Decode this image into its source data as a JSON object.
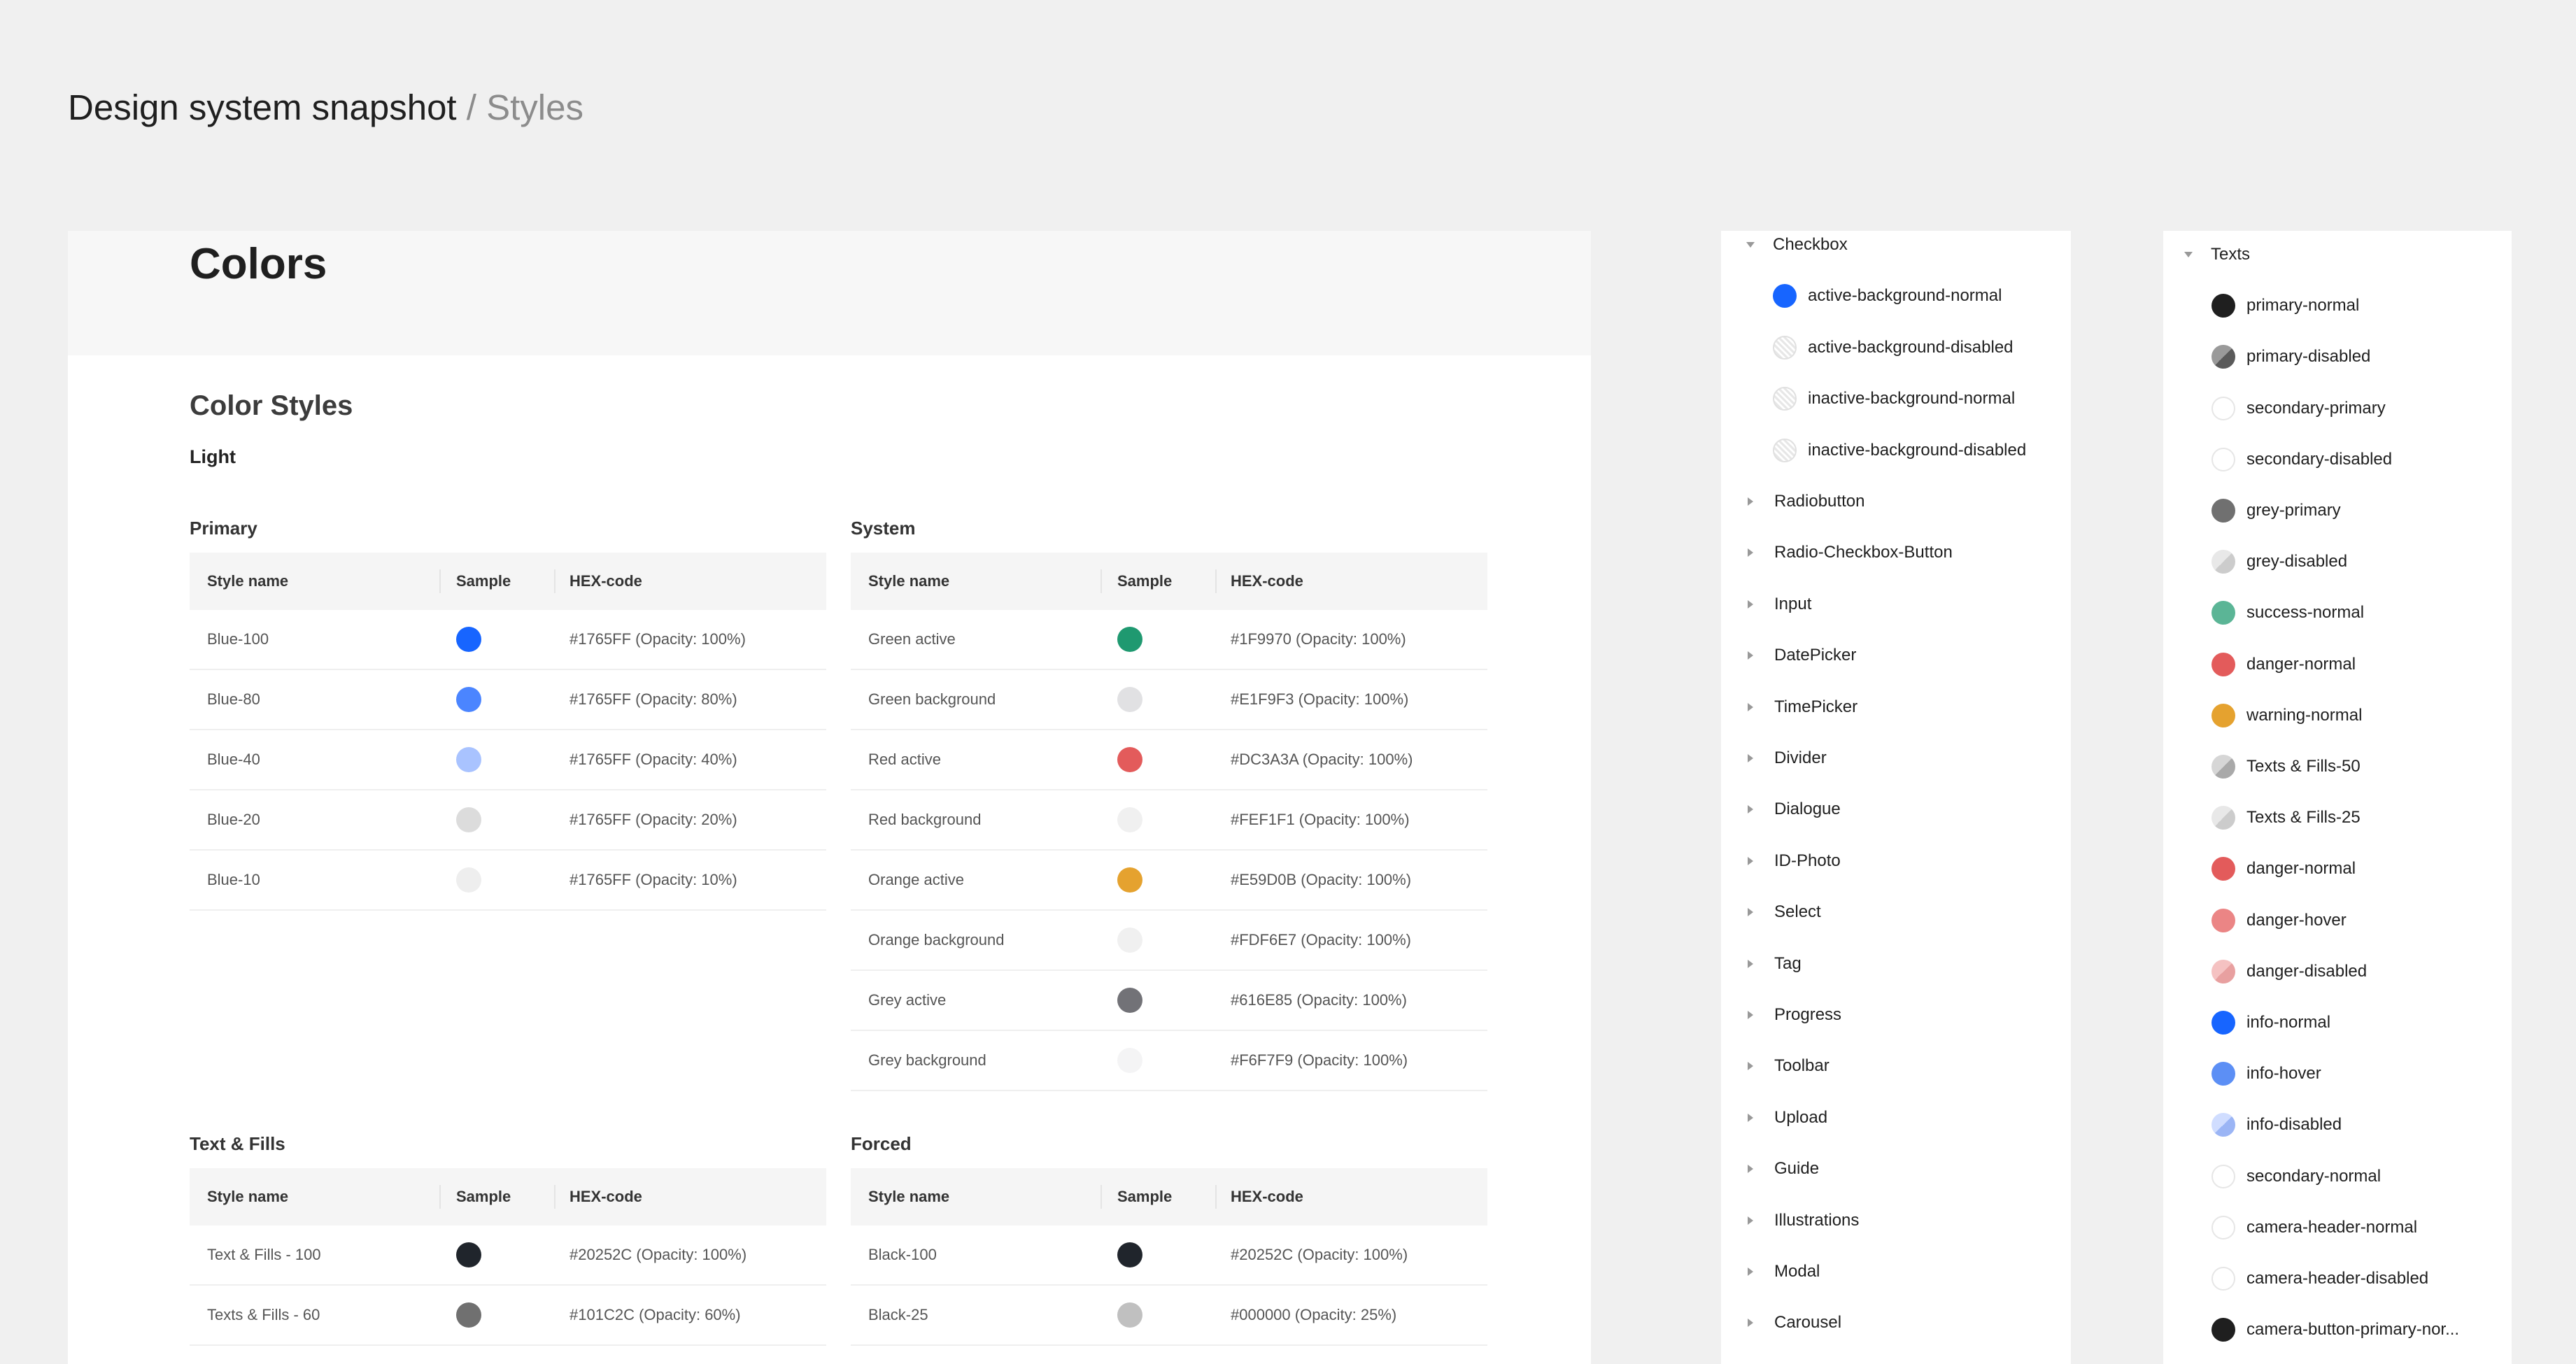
{
  "page": {
    "title": "Design system snapshot",
    "separator": " / ",
    "section": "Styles"
  },
  "board": {
    "title": "Colors",
    "subtitle": "Color Styles",
    "mode": "Light",
    "columns": {
      "name": "Style name",
      "sample": "Sample",
      "hex": "HEX-code"
    },
    "groups": {
      "primary": {
        "title": "Primary",
        "rows": [
          {
            "name": "Blue-100",
            "color": "#1765FF",
            "hex": "#1765FF (Opacity: 100%)"
          },
          {
            "name": "Blue-80",
            "color": "#4B85FF",
            "hex": "#1765FF (Opacity: 80%)"
          },
          {
            "name": "Blue-40",
            "color": "#A9C3FF",
            "hex": "#1765FF (Opacity: 40%)"
          },
          {
            "name": "Blue-20",
            "color": "#DCDCDC",
            "hex": "#1765FF (Opacity: 20%)"
          },
          {
            "name": "Blue-10",
            "color": "#EEEEEE",
            "hex": "#1765FF (Opacity: 10%)"
          }
        ]
      },
      "system": {
        "title": "System",
        "rows": [
          {
            "name": "Green active",
            "color": "#1F9970",
            "hex": "#1F9970 (Opacity: 100%)"
          },
          {
            "name": "Green background",
            "color": "#E1E1E3",
            "hex": "#E1F9F3 (Opacity: 100%)"
          },
          {
            "name": "Red active",
            "color": "#E35B5B",
            "hex": "#DC3A3A (Opacity: 100%)"
          },
          {
            "name": "Red background",
            "color": "#F0F0F0",
            "hex": "#FEF1F1 (Opacity: 100%)"
          },
          {
            "name": "Orange active",
            "color": "#E5A22F",
            "hex": "#E59D0B (Opacity: 100%)"
          },
          {
            "name": "Orange background",
            "color": "#F0F0F0",
            "hex": "#FDF6E7 (Opacity: 100%)"
          },
          {
            "name": "Grey active",
            "color": "#727277",
            "hex": "#616E85 (Opacity: 100%)"
          },
          {
            "name": "Grey background",
            "color": "#F4F4F5",
            "hex": "#F6F7F9 (Opacity: 100%)"
          }
        ]
      },
      "text_fills": {
        "title": "Text & Fills",
        "rows": [
          {
            "name": "Text & Fills - 100",
            "color": "#20252C",
            "hex": "#20252C (Opacity: 100%)"
          },
          {
            "name": "Texts & Fills - 60",
            "color": "#707070",
            "hex": "#101C2C (Opacity: 60%)"
          }
        ]
      },
      "forced": {
        "title": "Forced",
        "rows": [
          {
            "name": "Black-100",
            "color": "#20252C",
            "hex": "#20252C (Opacity: 100%)"
          },
          {
            "name": "Black-25",
            "color": "#C0C0C0",
            "hex": "#000000 (Opacity: 25%)"
          }
        ]
      }
    }
  },
  "components_panel": {
    "expanded_title": "Checkbox",
    "expanded_items": [
      {
        "label": "active-background-normal",
        "swatch": "solid",
        "color": "#1765FF"
      },
      {
        "label": "active-background-disabled",
        "swatch": "hatch"
      },
      {
        "label": "inactive-background-normal",
        "swatch": "hatch"
      },
      {
        "label": "inactive-background-disabled",
        "swatch": "hatch"
      }
    ],
    "collapsed": [
      "Radiobutton",
      "Radio-Checkbox-Button",
      "Input",
      "DatePicker",
      "TimePicker",
      "Divider",
      "Dialogue",
      "ID-Photo",
      "Select",
      "Tag",
      "Progress",
      "Toolbar",
      "Upload",
      "Guide",
      "Illustrations",
      "Modal",
      "Carousel"
    ]
  },
  "texts_panel": {
    "title": "Texts",
    "items": [
      {
        "label": "primary-normal",
        "swatch": "solid",
        "color": "#1F1F1F"
      },
      {
        "label": "primary-disabled",
        "swatch": "split-dark"
      },
      {
        "label": "secondary-primary",
        "swatch": "empty"
      },
      {
        "label": "secondary-disabled",
        "swatch": "empty"
      },
      {
        "label": "grey-primary",
        "swatch": "solid",
        "color": "#707070"
      },
      {
        "label": "grey-disabled",
        "swatch": "split-light"
      },
      {
        "label": "success-normal",
        "swatch": "solid",
        "color": "#5BB596"
      },
      {
        "label": "danger-normal",
        "swatch": "solid",
        "color": "#E35B5B"
      },
      {
        "label": "warning-normal",
        "swatch": "solid",
        "color": "#E5A22F"
      },
      {
        "label": "Texts & Fills-50",
        "swatch": "split-grey"
      },
      {
        "label": "Texts & Fills-25",
        "swatch": "split-light"
      },
      {
        "label": "danger-normal",
        "swatch": "solid",
        "color": "#E35B5B"
      },
      {
        "label": "danger-hover",
        "swatch": "solid",
        "color": "#EB8585"
      },
      {
        "label": "danger-disabled",
        "swatch": "split-red"
      },
      {
        "label": "info-normal",
        "swatch": "solid",
        "color": "#1765FF"
      },
      {
        "label": "info-hover",
        "swatch": "solid",
        "color": "#5C8FF5"
      },
      {
        "label": "info-disabled",
        "swatch": "split-blue"
      },
      {
        "label": "secondary-normal",
        "swatch": "empty"
      },
      {
        "label": "camera-header-normal",
        "swatch": "empty"
      },
      {
        "label": "camera-header-disabled",
        "swatch": "empty"
      },
      {
        "label": "camera-button-primary-nor...",
        "swatch": "solid",
        "color": "#1F1F1F"
      }
    ]
  }
}
